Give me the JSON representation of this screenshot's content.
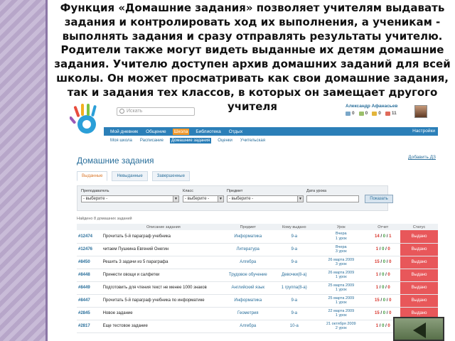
{
  "slide": {
    "heading": "Функция «Домашние задания» позволяет учителям выдавать задания и контролировать ход их выполнения, а ученикам - выполнять задания и сразу отправлять результаты учителю. Родители также могут видеть выданные их детям домашние задания. Учителю доступен архив домашних заданий для всей школы. Он может просматривать как свои домашние задания, так и задания тех классов, в которых он замещает другого учителя"
  },
  "header": {
    "search_placeholder": "Искать",
    "user_name": "Александр Афанасьев",
    "counters": [
      "0",
      "0",
      "0",
      "11"
    ]
  },
  "nav": {
    "items": [
      "Мой дневник",
      "Общение",
      "Школа",
      "Библиотека",
      "Отдых"
    ],
    "active": "Школа",
    "settings": "Настройки"
  },
  "subnav": {
    "items": [
      "Моя школа",
      "Расписание",
      "Домашние задания",
      "Оценки",
      "Учительская"
    ],
    "active": "Домашние задания"
  },
  "main": {
    "title": "Домашние задания",
    "add_link": "Добавить ДЗ",
    "tabs": [
      "Выданные",
      "Невыданные",
      "Завершенные"
    ],
    "filters": {
      "teacher_label": "Преподаватель",
      "teacher_value": "- выберите -",
      "class_label": "Класс",
      "class_value": "- выберите -",
      "subject_label": "Предмет",
      "subject_value": "- выберите -",
      "date_label": "Дата урока",
      "date_value": "",
      "show_button": "Показать"
    },
    "found_text": "Найдено 8 домашних заданий",
    "table": {
      "headers": [
        "",
        "Описание задания",
        "Предмет",
        "Кому выдано",
        "Урок",
        "Отчет",
        "Статус"
      ],
      "rows": [
        {
          "num": "#12474",
          "desc": "Прочитать 5-й параграф учебника",
          "subject": "Информатика",
          "to": "9-а",
          "lesson1": "Вчера",
          "lesson2": "1 урок",
          "r1": "14",
          "r2": "0",
          "r3": "1",
          "status": "Выдано"
        },
        {
          "num": "#12476",
          "desc": "читаем Пушкина Евгений Онегин",
          "subject": "Литература",
          "to": "9-а",
          "lesson1": "Вчера",
          "lesson2": "3 урок",
          "r1": "1",
          "r2": "0",
          "r3": "0",
          "status": "Выдано"
        },
        {
          "num": "#8450",
          "desc": "Решить 3 задачи из 5 параграфа",
          "subject": "Алгебра",
          "to": "9-а",
          "lesson1": "26 марта 2009",
          "lesson2": "3 урок",
          "r1": "15",
          "r2": "0",
          "r3": "0",
          "status": "Выдано"
        },
        {
          "num": "#8448",
          "desc": "Принести овощи и салфетки",
          "subject": "Трудовое обучение",
          "to": "Девочки(8-а)",
          "lesson1": "26 марта 2009",
          "lesson2": "1 урок",
          "r1": "1",
          "r2": "0",
          "r3": "0",
          "status": "Выдано"
        },
        {
          "num": "#8449",
          "desc": "Подготовить для чтения текст не менее 1000 знаков",
          "subject": "Английский язык",
          "to": "1 группа(8-а)",
          "lesson1": "25 марта 2009",
          "lesson2": "1 урок",
          "r1": "1",
          "r2": "0",
          "r3": "0",
          "status": "Выдано"
        },
        {
          "num": "#8447",
          "desc": "Прочитать 5-й параграф учебника по информатике",
          "subject": "Информатика",
          "to": "9-а",
          "lesson1": "25 марта 2009",
          "lesson2": "1 урок",
          "r1": "15",
          "r2": "0",
          "r3": "0",
          "status": "Выдано"
        },
        {
          "num": "#2845",
          "desc": "Новое задание",
          "subject": "Геометрия",
          "to": "9-а",
          "lesson1": "22 марта 2009",
          "lesson2": "1 урок",
          "r1": "15",
          "r2": "0",
          "r3": "0",
          "status": "Выдано"
        },
        {
          "num": "#2817",
          "desc": "Еще тестовое задание",
          "subject": "Алгебра",
          "to": "10-а",
          "lesson1": "21 октября 2009",
          "lesson2": "2 урок",
          "r1": "1",
          "r2": "0",
          "r3": "0",
          "status": "Выдано"
        }
      ]
    }
  },
  "colors": {
    "nav_blue": "#2b7fb8",
    "active_orange": "#f29a2e",
    "status_red": "#e8575a",
    "stripe_purple": "#b7a6c9"
  }
}
